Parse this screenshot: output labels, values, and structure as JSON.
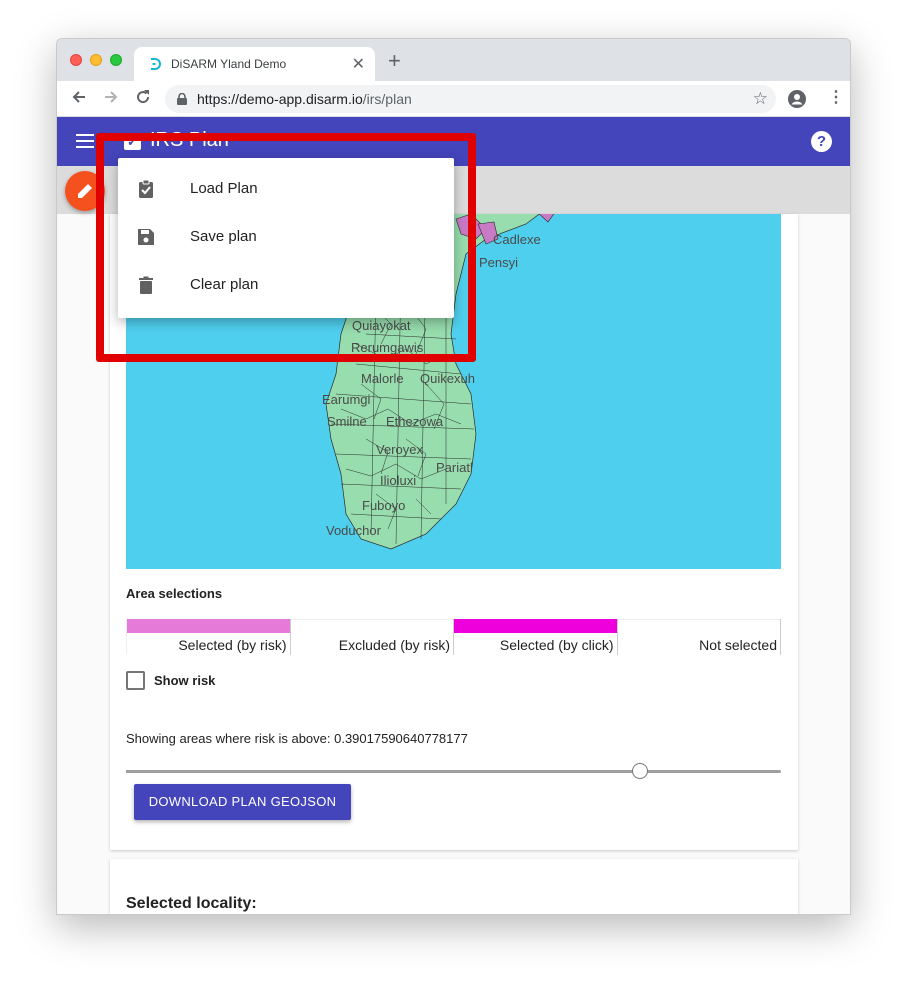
{
  "browser": {
    "tab_title": "DiSARM Yland Demo",
    "tab_close": "✕",
    "new_tab": "+",
    "url_host": "https://demo-app.disarm.io",
    "url_path": "/irs/plan"
  },
  "appbar": {
    "title": "IRS Plan",
    "help": "?"
  },
  "menu": {
    "items": [
      {
        "label": "Load Plan",
        "icon": "clipboard-check-icon"
      },
      {
        "label": "Save plan",
        "icon": "save-icon"
      },
      {
        "label": "Clear plan",
        "icon": "trash-icon"
      }
    ]
  },
  "map": {
    "place_labels": [
      "Cadlexe",
      "Pensyi",
      "Quiayokat",
      "Rerumgawis",
      "Malorle",
      "Quikexuh",
      "Earumgi",
      "Smilne",
      "Ethezowa",
      "Veroyex",
      "Pariatl",
      "Ilioluxi",
      "Fuboyo",
      "Voduchor"
    ],
    "colors": {
      "water": "#4fcfee",
      "land": "#97ddae",
      "selected_risk": "#e57ad8"
    }
  },
  "plan": {
    "area_selections_title": "Area selections",
    "legend": [
      {
        "label": "Selected (by risk)",
        "color": "#e57ad8"
      },
      {
        "label": "Excluded (by risk)",
        "color": "#ffffff"
      },
      {
        "label": "Selected (by click)",
        "color": "#ee00dd"
      },
      {
        "label": "Not selected",
        "color": "#ffffff"
      }
    ],
    "show_risk_label": "Show risk",
    "risk_text": "Showing areas where risk is above: 0.39017590640778177",
    "risk_threshold": 0.39017590640778177,
    "slider_position": 0.785,
    "download_button": "DOWNLOAD PLAN GEOJSON"
  },
  "locality": {
    "title": "Selected locality:"
  },
  "colors": {
    "primary": "#4444bb",
    "fab": "#f4511e",
    "highlight": "#e00000"
  }
}
